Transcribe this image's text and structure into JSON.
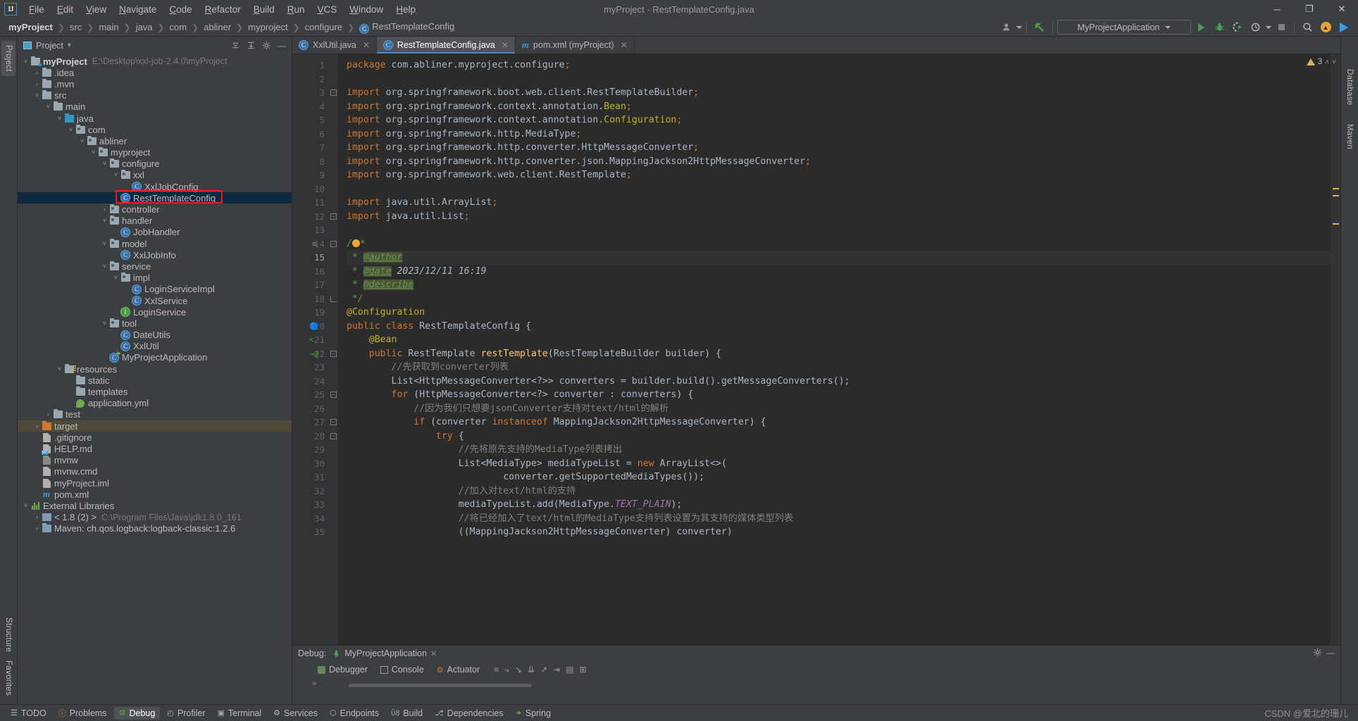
{
  "window": {
    "title": "myProject - RestTemplateConfig.java",
    "logo": "IJ",
    "minimize": "─",
    "maximize": "❐",
    "close": "✕"
  },
  "menu": [
    "File",
    "Edit",
    "View",
    "Navigate",
    "Code",
    "Refactor",
    "Build",
    "Run",
    "VCS",
    "Window",
    "Help"
  ],
  "breadcrumb": {
    "items": [
      "myProject",
      "src",
      "main",
      "java",
      "com",
      "abliner",
      "myproject",
      "configure"
    ],
    "leaf": "RestTemplateConfig",
    "leaf_icon": "C",
    "separator": "❯"
  },
  "toolbar": {
    "profile_icon": "user-icon",
    "vcs_update_icon": "vcs-update-arrow",
    "run_config": "MyProjectApplication",
    "run_label": "run-icon",
    "debug_label": "debug-bug-icon",
    "coverage_label": "run-with-coverage-icon",
    "profiler_label": "profiler-icon",
    "stop_label": "stop-icon",
    "search_label": "search-icon",
    "updates_label": "update-icon",
    "ide_label": "ide-icon"
  },
  "project_panel": {
    "title": "Project",
    "dropdown": "▾",
    "buttons": [
      "collapse-all-icon",
      "expand-select-icon",
      "settings-gear-icon",
      "hide-icon"
    ],
    "tree": [
      {
        "depth": 0,
        "arrow": "˅",
        "icon": "project-folder",
        "label": "myProject",
        "bold": true,
        "path": "E:\\Desktop\\xxl-job-2.4.0\\myProject"
      },
      {
        "depth": 1,
        "arrow": "›",
        "icon": "folder",
        "label": ".idea"
      },
      {
        "depth": 1,
        "arrow": "›",
        "icon": "folder",
        "label": ".mvn"
      },
      {
        "depth": 1,
        "arrow": "˅",
        "icon": "folder",
        "label": "src"
      },
      {
        "depth": 2,
        "arrow": "˅",
        "icon": "folder",
        "label": "main"
      },
      {
        "depth": 3,
        "arrow": "˅",
        "icon": "folder-source",
        "label": "java"
      },
      {
        "depth": 4,
        "arrow": "˅",
        "icon": "folder-package",
        "label": "com"
      },
      {
        "depth": 5,
        "arrow": "˅",
        "icon": "folder-package",
        "label": "abliner"
      },
      {
        "depth": 6,
        "arrow": "˅",
        "icon": "folder-package",
        "label": "myproject"
      },
      {
        "depth": 7,
        "arrow": "˅",
        "icon": "folder-package",
        "label": "configure"
      },
      {
        "depth": 8,
        "arrow": "˅",
        "icon": "folder-package",
        "label": "xxl"
      },
      {
        "depth": 9,
        "arrow": "",
        "icon": "class",
        "label": "XxlJobConfig"
      },
      {
        "depth": 8,
        "arrow": "",
        "icon": "class",
        "label": "RestTemplateConfig",
        "selected": true,
        "highlighted": true
      },
      {
        "depth": 7,
        "arrow": "›",
        "icon": "folder-package",
        "label": "controller"
      },
      {
        "depth": 7,
        "arrow": "˅",
        "icon": "folder-package",
        "label": "handler"
      },
      {
        "depth": 8,
        "arrow": "",
        "icon": "class",
        "label": "JobHandler"
      },
      {
        "depth": 7,
        "arrow": "˅",
        "icon": "folder-package",
        "label": "model"
      },
      {
        "depth": 8,
        "arrow": "",
        "icon": "class",
        "label": "XxlJobInfo"
      },
      {
        "depth": 7,
        "arrow": "˅",
        "icon": "folder-package",
        "label": "service"
      },
      {
        "depth": 8,
        "arrow": "˅",
        "icon": "folder-package",
        "label": "impl"
      },
      {
        "depth": 9,
        "arrow": "",
        "icon": "class",
        "label": "LoginServiceImpl"
      },
      {
        "depth": 9,
        "arrow": "",
        "icon": "class",
        "label": "XxlService"
      },
      {
        "depth": 8,
        "arrow": "",
        "icon": "interface",
        "label": "LoginService"
      },
      {
        "depth": 7,
        "arrow": "˅",
        "icon": "folder-package",
        "label": "tool"
      },
      {
        "depth": 8,
        "arrow": "",
        "icon": "class",
        "label": "DateUtils"
      },
      {
        "depth": 8,
        "arrow": "",
        "icon": "class",
        "label": "XxlUtil"
      },
      {
        "depth": 7,
        "arrow": "",
        "icon": "spring-class",
        "label": "MyProjectApplication"
      },
      {
        "depth": 3,
        "arrow": "˅",
        "icon": "folder-resources",
        "label": "resources"
      },
      {
        "depth": 4,
        "arrow": "",
        "icon": "folder",
        "label": "static"
      },
      {
        "depth": 4,
        "arrow": "",
        "icon": "folder",
        "label": "templates"
      },
      {
        "depth": 4,
        "arrow": "",
        "icon": "yml-file",
        "label": "application.yml"
      },
      {
        "depth": 2,
        "arrow": "›",
        "icon": "folder",
        "label": "test"
      },
      {
        "depth": 1,
        "arrow": "›",
        "icon": "folder-target",
        "label": "target",
        "target": true
      },
      {
        "depth": 1,
        "arrow": "",
        "icon": "file",
        "label": ".gitignore"
      },
      {
        "depth": 1,
        "arrow": "",
        "icon": "md-file",
        "label": "HELP.md"
      },
      {
        "depth": 1,
        "arrow": "",
        "icon": "sh-file",
        "label": "mvnw"
      },
      {
        "depth": 1,
        "arrow": "",
        "icon": "file",
        "label": "mvnw.cmd"
      },
      {
        "depth": 1,
        "arrow": "",
        "icon": "file",
        "label": "myProject.iml"
      },
      {
        "depth": 1,
        "arrow": "",
        "icon": "maven-file",
        "label": "pom.xml"
      },
      {
        "depth": 0,
        "arrow": "˅",
        "icon": "libraries",
        "label": "External Libraries"
      },
      {
        "depth": 1,
        "arrow": "›",
        "icon": "jdk",
        "label": "< 1.8 (2) >",
        "path": "C:\\Program Files\\Java\\jdk1.8.0_161"
      },
      {
        "depth": 1,
        "arrow": "›",
        "icon": "maven-lib",
        "label": "Maven: ch.qos.logback:logback-classic:1.2.6"
      }
    ]
  },
  "editor": {
    "tabs": [
      {
        "icon": "C",
        "label": "XxlUtil.java",
        "active": false,
        "close": "✕"
      },
      {
        "icon": "C",
        "label": "RestTemplateConfig.java",
        "active": true,
        "close": "✕"
      },
      {
        "icon": "m",
        "label": "pom.xml (myProject)",
        "active": false,
        "close": "✕"
      }
    ],
    "warnings": {
      "count": "3",
      "icon": "warning-triangle",
      "up": "˄",
      "down": "˅"
    },
    "lines": [
      {
        "n": 1,
        "html": "<span class='k'>package</span> <span class='n'>com.abliner.myproject.configure</span><span class='k'>;</span>"
      },
      {
        "n": 2,
        "html": ""
      },
      {
        "n": 3,
        "html": "<span class='k'>import</span> <span class='n'>org.springframework.boot.web.client.</span><span class='n'>RestTemplateBuilder</span><span class='k'>;</span>",
        "fold": "minus"
      },
      {
        "n": 4,
        "html": "<span class='k'>import</span> <span class='n'>org.springframework.context.annotation.</span><span class='ann'>Bean</span><span class='k'>;</span>"
      },
      {
        "n": 5,
        "html": "<span class='k'>import</span> <span class='n'>org.springframework.context.annotation.</span><span class='ann'>Configuration</span><span class='k'>;</span>"
      },
      {
        "n": 6,
        "html": "<span class='k'>import</span> <span class='n'>org.springframework.http.MediaType</span><span class='k'>;</span>"
      },
      {
        "n": 7,
        "html": "<span class='k'>import</span> <span class='n'>org.springframework.http.converter.HttpMessageConverter</span><span class='k'>;</span>"
      },
      {
        "n": 8,
        "html": "<span class='k'>import</span> <span class='n'>org.springframework.http.converter.json.MappingJackson2HttpMessageConverter</span><span class='k'>;</span>"
      },
      {
        "n": 9,
        "html": "<span class='k'>import</span> <span class='n'>org.springframework.web.client.RestTemplate</span><span class='k'>;</span>"
      },
      {
        "n": 10,
        "html": ""
      },
      {
        "n": 11,
        "html": "<span class='k'>import</span> <span class='n'>java.util.ArrayList</span><span class='k'>;</span>"
      },
      {
        "n": 12,
        "html": "<span class='k'>import</span> <span class='n'>java.util.List</span><span class='k'>;</span>",
        "fold": "minus"
      },
      {
        "n": 13,
        "html": ""
      },
      {
        "n": 14,
        "html": "<span class='jd'>/</span><span class='bulb'></span><span class='jd'>*</span>",
        "fold": "minus",
        "gmark": "structure"
      },
      {
        "n": 15,
        "html": " <span class='jd'>* </span><span class='jdt'>@author</span>",
        "cur": true
      },
      {
        "n": 16,
        "html": " <span class='jd'>* </span><span class='jdt'>@date</span><span class='jdv'> 2023/12/11 16:19</span>"
      },
      {
        "n": 17,
        "html": " <span class='jd'>* </span><span class='jdt'>@describe</span>"
      },
      {
        "n": 18,
        "html": " <span class='jd'>*/</span>",
        "fold": "end"
      },
      {
        "n": 19,
        "html": "<span class='ann'>@Configuration</span>"
      },
      {
        "n": 20,
        "html": "<span class='k'>public class</span> <span class='n'>RestTemplateConfig</span> {",
        "gmark": "bean"
      },
      {
        "n": 21,
        "html": "    <span class='ann'>@Bean</span>",
        "gmark": "override"
      },
      {
        "n": 22,
        "html": "    <span class='k'>public</span> <span class='n'>RestTemplate</span> <span class='f'>restTemplate</span>(<span class='n'>RestTemplateBuilder</span> <span class='n'>builder</span>) {",
        "gmark": "bean-at",
        "fold": "minus"
      },
      {
        "n": 23,
        "html": "        <span class='cm'>//先获取到converter列表</span>"
      },
      {
        "n": 24,
        "html": "        <span class='n'>List&lt;HttpMessageConverter&lt;?&gt;&gt; converters = builder.build().getMessageConverters();</span>"
      },
      {
        "n": 25,
        "html": "        <span class='k'>for</span> (<span class='n'>HttpMessageConverter&lt;?&gt; converter : converters</span>) {",
        "fold": "minus"
      },
      {
        "n": 26,
        "html": "            <span class='cm'>//因为我们只想要jsonConverter支持对text/html的解析</span>"
      },
      {
        "n": 27,
        "html": "            <span class='k'>if</span> (<span class='n'>converter</span> <span class='k'>instanceof</span> <span class='n'>MappingJackson2HttpMessageConverter</span>) {",
        "fold": "minus"
      },
      {
        "n": 28,
        "html": "                <span class='k'>try</span> {",
        "fold": "minus"
      },
      {
        "n": 29,
        "html": "                    <span class='cm'>//先将原先支持的MediaType列表拷出</span>"
      },
      {
        "n": 30,
        "html": "                    <span class='n'>List&lt;MediaType&gt; mediaTypeList = </span><span class='k'>new</span> <span class='n'>ArrayList&lt;&gt;(</span>"
      },
      {
        "n": 31,
        "html": "                            <span class='n'>converter.getSupportedMediaTypes());</span>"
      },
      {
        "n": 32,
        "html": "                    <span class='cm'>//加入对text/html的支持</span>"
      },
      {
        "n": 33,
        "html": "                    <span class='n'>mediaTypeList.add(MediaType.</span><span class='st'>TEXT_PLAIN</span><span class='n'>);</span>"
      },
      {
        "n": 34,
        "html": "                    <span class='cm'>//将已经加入了text/html的MediaType支持列表设置为其支持的媒体类型列表</span>"
      },
      {
        "n": 35,
        "html": "                    <span class='n'>((MappingJackson2HttpMessageConverter) converter)</span>"
      }
    ]
  },
  "debug": {
    "label": "Debug:",
    "config": "MyProjectApplication",
    "close": "✕",
    "tabs": [
      {
        "icon": "debugger-icon",
        "label": "Debugger",
        "active": false
      },
      {
        "icon": "console-icon",
        "label": "Console",
        "active": false
      },
      {
        "icon": "actuator-icon",
        "label": "Actuator",
        "active": false
      }
    ],
    "tools": [
      "menu-icon",
      "step-over-icon",
      "step-into-icon",
      "force-step-into-icon",
      "step-out-icon",
      "run-to-cursor-icon",
      "evaluate-icon",
      "layout-icon"
    ],
    "settings_icon": "gear-icon",
    "hide_icon": "hide-icon",
    "expand_icon": "»"
  },
  "statusbar": {
    "items": [
      {
        "icon": "todo-icon",
        "label": "TODO",
        "active": false
      },
      {
        "icon": "problems-icon",
        "label": "Problems",
        "active": false
      },
      {
        "icon": "debug-icon",
        "label": "Debug",
        "active": true
      },
      {
        "icon": "profiler-icon",
        "label": "Profiler",
        "active": false
      },
      {
        "icon": "terminal-icon",
        "label": "Terminal",
        "active": false
      },
      {
        "icon": "services-icon",
        "label": "Services",
        "active": false
      },
      {
        "icon": "endpoints-icon",
        "label": "Endpoints",
        "active": false
      },
      {
        "icon": "build-icon",
        "label": "Build",
        "active": false
      },
      {
        "icon": "dependencies-icon",
        "label": "Dependencies",
        "active": false
      },
      {
        "icon": "spring-icon",
        "label": "Spring",
        "active": false
      }
    ],
    "watermark": "CSDN @爱北的珊儿"
  },
  "rails": {
    "left": [
      "Project",
      "Structure",
      "Favorites"
    ],
    "right": [
      "Database",
      "Maven"
    ]
  },
  "colors": {
    "accent": "#4a88c7",
    "selection": "#0d293e",
    "highlight_red": "#ee1c25",
    "editor_bg": "#2b2b2b",
    "panel_bg": "#3c3f41"
  }
}
